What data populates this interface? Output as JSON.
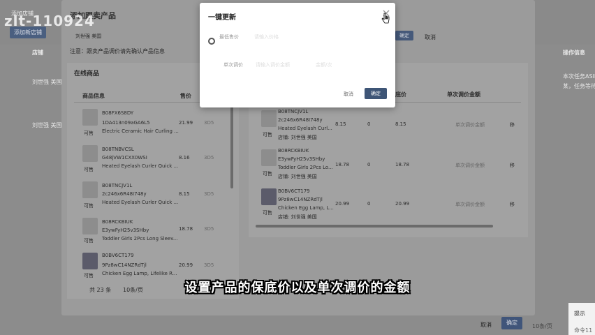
{
  "app": {
    "top_left_label": "添加店铺",
    "add_button": "添加新店铺",
    "col_store": "店铺",
    "col_action_info": "操作信息",
    "row_store_1": "刘世强 美国",
    "row_store_2": "刘世强 美国",
    "action_info_text_1": "本次任务ASIN数",
    "action_info_text_2": "某，任务等待中",
    "tip_title": "提示",
    "tip_text": "命令11",
    "page_size_right": "10条/页"
  },
  "modal": {
    "title": "添加跟卖产品",
    "store_select": "刘世强 美国",
    "notice": "注意：跟卖产品调价请先确认产品信息",
    "online_products_title": "在线商品",
    "col_product_info": "商品信息",
    "col_price": "售价",
    "status_available": "可售",
    "products": [
      {
        "asin": "B08FX6S8DY",
        "sku": "1DA413n09aGA6L5",
        "name": "Electric Ceramic Hair Curling ...",
        "price": "21.99",
        "extra": "3D5"
      },
      {
        "asin": "B08TNBVCSL",
        "sku": "G48jVW1CXX0WSI",
        "name": "Heated Eyelash Curler Quick ...",
        "price": "8.16",
        "extra": "3D5"
      },
      {
        "asin": "B08TNCJV1L",
        "sku": "2c246x6R48I748y",
        "name": "Heated Eyelash Curler Quick ...",
        "price": "8.15",
        "extra": "3D5"
      },
      {
        "asin": "B08RCKBIUK",
        "sku": "E3ywFyH25v3SHby",
        "name": "Toddler Girls 2Pcs Long Sleev...",
        "price": "18.78",
        "extra": "3D5"
      },
      {
        "asin": "B0BV6CT179",
        "sku": "9Pz8wC14NZRdTjl",
        "name": "Chicken Egg Lamp, Lifelike R...",
        "price": "20.99",
        "extra": "3D5"
      }
    ],
    "total": "共 23 条",
    "page_size": "10条/页",
    "selected_btn": "确定",
    "cancel_btn": "取消",
    "right_cols": {
      "floor_price": "底价",
      "single_adjust": "单次调价金额"
    },
    "selected_products": [
      {
        "asin": "B08TNCJV1L",
        "sku": "2c246x6R48I748y",
        "name": "Heated Eyelash Curl...",
        "store": "店铺: 刘世强 美国",
        "price": "8.15",
        "count": "0",
        "floor": "8.15",
        "adjust": "单次调价金额",
        "op": "移"
      },
      {
        "asin": "B08RCKBIUK",
        "sku": "E3ywFyH25v3SHby",
        "name": "Toddler Girls 2Pcs Lo...",
        "store": "店铺: 刘世强 美国",
        "price": "18.78",
        "count": "0",
        "floor": "18.78",
        "adjust": "单次调价金额",
        "op": "移"
      },
      {
        "asin": "B0BV6CT179",
        "sku": "9Pz8wC14NZRdTjl",
        "name": "Chicken Egg Lamp, L...",
        "store": "店铺: 刘世强 美国",
        "price": "20.99",
        "count": "0",
        "floor": "20.99",
        "adjust": "单次调价金额",
        "op": "移"
      }
    ],
    "footer_cancel": "取消",
    "footer_ok": "确定"
  },
  "dialog": {
    "title": "一键更新",
    "field1_label": "最低售价",
    "field1_value": "请输入价格",
    "field2_label": "单次调价",
    "field2_value": "请输入调价金额",
    "field2_unit": "金额/次",
    "cancel": "取消",
    "ok": "确定"
  },
  "subtitle": "设置产品的保底价以及单次调价的金额",
  "watermark": "zlt-110924"
}
